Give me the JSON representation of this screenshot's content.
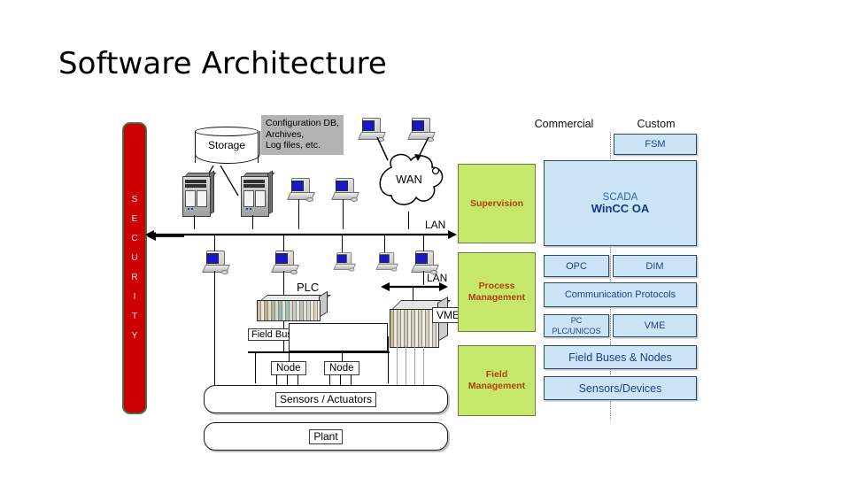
{
  "slide": {
    "title": "Software Architecture",
    "background_color": "#ffffff"
  },
  "diagram": {
    "security_bar": {
      "label": "SECURITY",
      "letters": [
        "S",
        "E",
        "C",
        "U",
        "R",
        "I",
        "T",
        "Y"
      ],
      "fill_color": "#cc0000",
      "border_color": "#4c6b47",
      "text_color": "#ffe8e8"
    },
    "infrastructure": {
      "storage_label": "Storage",
      "note_lines": [
        "Configuration DB,",
        "Archives,",
        "Log files, etc."
      ],
      "note_bg_color": "#b3b3b3",
      "wan_label": "WAN",
      "lan_top_label": "LAN",
      "lan_mid_label": "LAN",
      "plc_label": "PLC",
      "vme_label": "VME",
      "field_bus_label": "Field Bus",
      "node_label_1": "Node",
      "node_label_2": "Node",
      "sensors_actuators_label": "Sensors / Actuators",
      "plant_label": "Plant"
    },
    "layers": {
      "fill_color": "#c6e86a",
      "text_color": "#b1400a",
      "items": [
        {
          "label": "Supervision",
          "lines": [
            "Supervision"
          ]
        },
        {
          "label": "Process Management",
          "lines": [
            "Process",
            "Management"
          ]
        },
        {
          "label": "Field Management",
          "lines": [
            "Field",
            "Management"
          ]
        }
      ]
    },
    "stack": {
      "fill_color": "#cbe5f7",
      "border_color": "#2e4a63",
      "text_color": "#1f3f88",
      "column_headers": [
        "Commercial",
        "Custom"
      ],
      "fsm_label": "FSM",
      "scada_line1": "SCADA",
      "scada_line2": "WinCC OA",
      "opc_label": "OPC",
      "dim_label": "DIM",
      "comm_protocols_label": "Communication Protocols",
      "pc_plc_line1": "PC",
      "pc_plc_line2": "PLC/UNICOS",
      "vme_label": "VME",
      "field_buses_label": "Field Buses & Nodes",
      "sensors_devices_label": "Sensors/Devices"
    }
  }
}
